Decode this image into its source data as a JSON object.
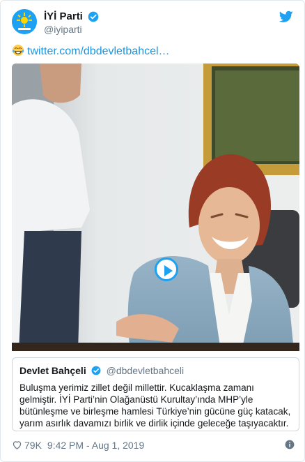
{
  "author": {
    "name": "İYİ Parti",
    "handle": "@iyiparti"
  },
  "tweet": {
    "emoji": "face-with-tears-of-joy",
    "link_text": "twitter.com/dbdevletbahcel…"
  },
  "media": {
    "type": "video",
    "play_icon": "play-icon"
  },
  "quote": {
    "name": "Devlet Bahçeli",
    "handle": "@dbdevletbahceli",
    "text": "Buluşma yerimiz zillet değil millettir. Kucaklaşma zamanı gelmiştir. İYİ Parti’nin Olağanüstü Kurultay’ında MHP’yle bütünleşme ve birleşme hamlesi Türkiye’nin gücüne güç katacak, yarım asırlık davamızı birlik ve dirlik içinde geleceğe taşıyacaktır."
  },
  "footer": {
    "likes": "79K",
    "timestamp": "9:42 PM - Aug 1, 2019"
  },
  "colors": {
    "twitter_blue": "#1da1f2",
    "link_blue": "#1b95e0",
    "muted": "#657786",
    "heart": "#657786"
  }
}
